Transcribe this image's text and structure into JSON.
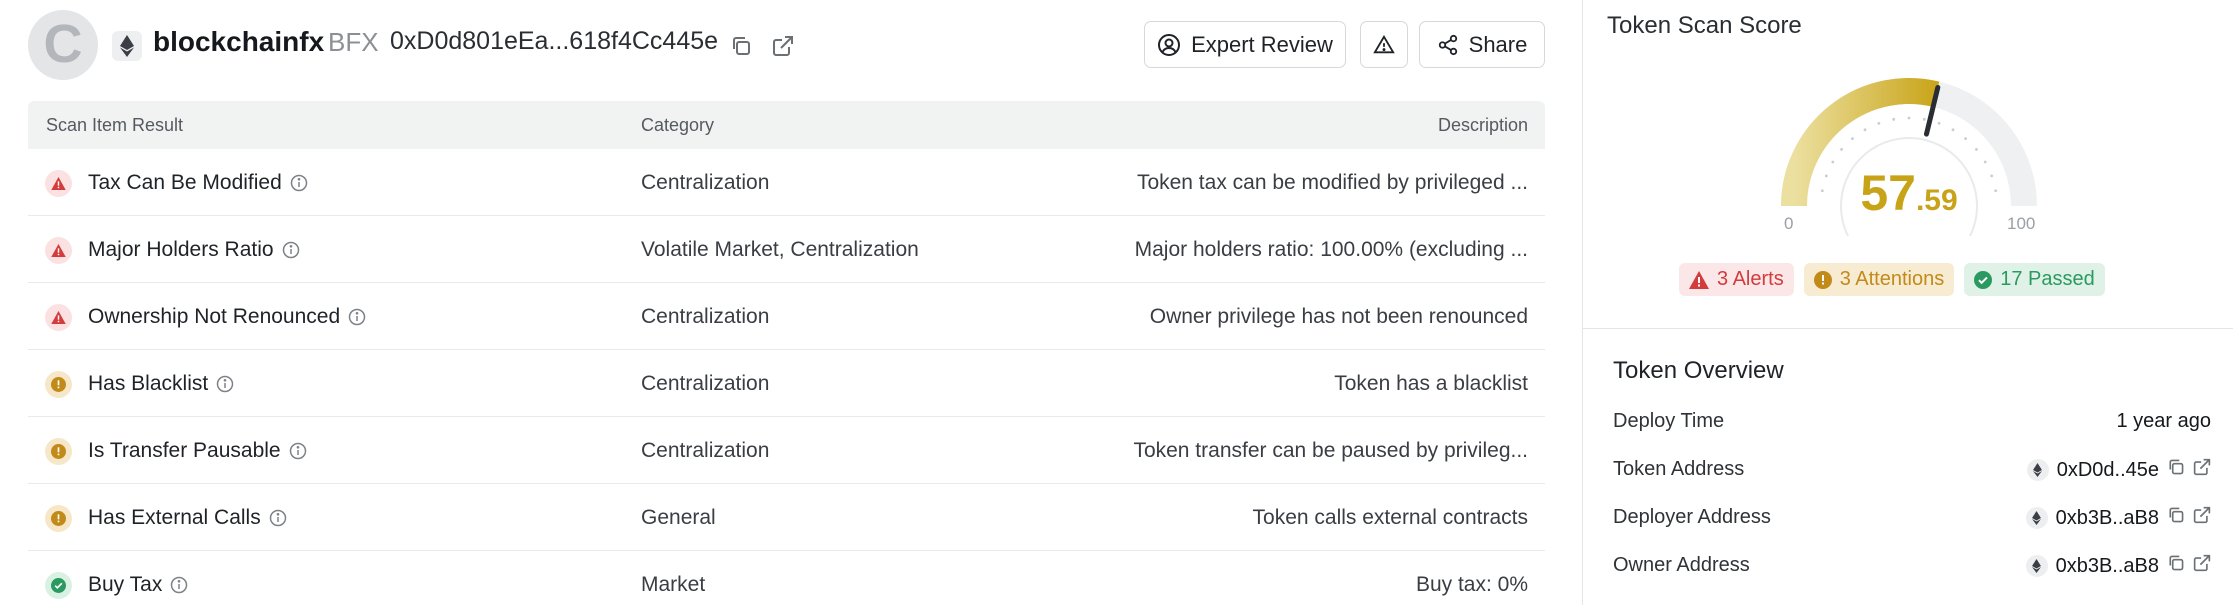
{
  "header": {
    "logo_letter": "C",
    "token_name": "blockchainfx",
    "token_symbol": "BFX",
    "contract_address": "0xD0d801eEa...618f4Cc445e",
    "expert_review_label": "Expert Review",
    "share_label": "Share"
  },
  "table": {
    "headers": {
      "item": "Scan Item Result",
      "category": "Category",
      "description": "Description"
    },
    "rows": [
      {
        "status": "alert",
        "name": "Tax Can Be Modified",
        "category": "Centralization",
        "description": "Token tax can be modified by privileged ..."
      },
      {
        "status": "alert",
        "name": "Major Holders Ratio",
        "category": "Volatile Market, Centralization",
        "description": "Major holders ratio: 100.00% (excluding ..."
      },
      {
        "status": "alert",
        "name": "Ownership Not Renounced",
        "category": "Centralization",
        "description": "Owner privilege has not been renounced"
      },
      {
        "status": "attention",
        "name": "Has Blacklist",
        "category": "Centralization",
        "description": "Token has a blacklist"
      },
      {
        "status": "attention",
        "name": "Is Transfer Pausable",
        "category": "Centralization",
        "description": "Token transfer can be paused by privileg..."
      },
      {
        "status": "attention",
        "name": "Has External Calls",
        "category": "General",
        "description": "Token calls external contracts"
      },
      {
        "status": "pass",
        "name": "Buy Tax",
        "category": "Market",
        "description": "Buy tax: 0%"
      }
    ]
  },
  "score": {
    "title": "Token Scan Score",
    "value": 57.59,
    "value_int": "57",
    "value_dec": ".59",
    "min_label": "0",
    "max_label": "100",
    "alerts_label": "3 Alerts",
    "attentions_label": "3 Attentions",
    "passed_label": "17 Passed"
  },
  "overview": {
    "title": "Token Overview",
    "deploy_time_label": "Deploy Time",
    "deploy_time_value": "1 year ago",
    "token_address_label": "Token Address",
    "token_address_value": "0xD0d..45e",
    "deployer_address_label": "Deployer Address",
    "deployer_address_value": "0xb3B..aB8",
    "owner_address_label": "Owner Address",
    "owner_address_value": "0xb3B..aB8"
  },
  "colors": {
    "alert": "#d23c3c",
    "attention": "#c28a18",
    "pass": "#2a9a60",
    "gauge_fill": "#c8a318",
    "gauge_track": "#eef0f1"
  },
  "icons": {
    "chain": "ethereum-icon",
    "copy": "copy-icon",
    "external": "external-link-icon",
    "expert": "user-circle-icon",
    "report": "warning-triangle-icon",
    "share": "share-icon",
    "info": "info-icon"
  }
}
